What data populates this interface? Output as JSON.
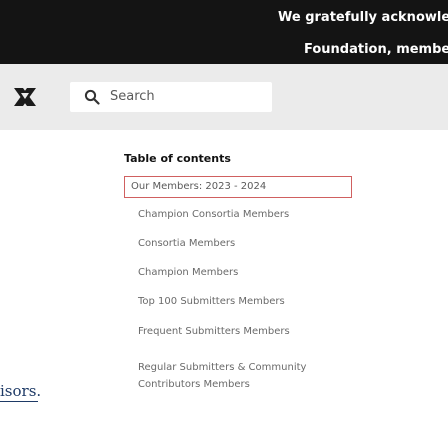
{
  "banner": {
    "line1": "We gratefully acknowledge",
    "line2": "Foundation, member insti"
  },
  "nav": {
    "logo_icon": "arxiv-logo-icon",
    "search_icon": "search-icon",
    "search_placeholder": "Search"
  },
  "toc": {
    "title": "Table of contents",
    "items": [
      "Our Members: 2023 - 2024",
      "Champion Consortia Members",
      "Consortia Members",
      "Champion Members",
      "Top 100 Submitters Members",
      "Frequent Submitters Members",
      "Regular Submitters & Community",
      "Contributors Members"
    ]
  },
  "side_text": "isors."
}
